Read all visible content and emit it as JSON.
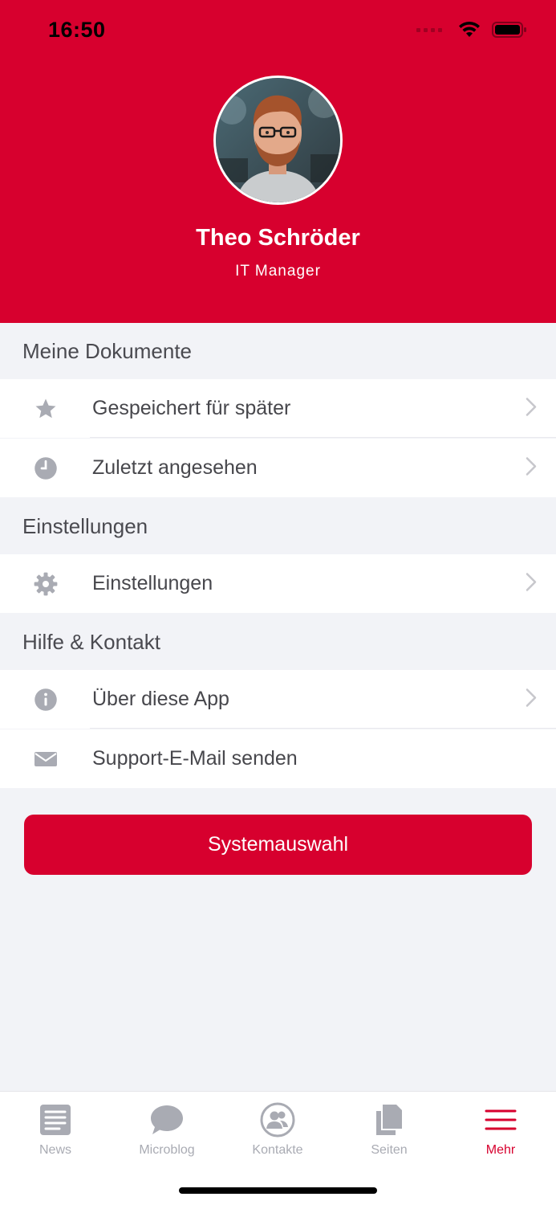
{
  "status_bar": {
    "time": "16:50"
  },
  "profile": {
    "name": "Theo Schröder",
    "role": "IT Manager"
  },
  "sections": [
    {
      "title": "Meine Dokumente",
      "items": [
        {
          "label": "Gespeichert für später",
          "icon": "star-icon"
        },
        {
          "label": "Zuletzt angesehen",
          "icon": "clock-icon"
        }
      ]
    },
    {
      "title": "Einstellungen",
      "items": [
        {
          "label": "Einstellungen",
          "icon": "gear-icon"
        }
      ]
    },
    {
      "title": "Hilfe & Kontakt",
      "items": [
        {
          "label": "Über diese App",
          "icon": "info-icon"
        },
        {
          "label": "Support-E-Mail senden",
          "icon": "mail-icon"
        }
      ]
    }
  ],
  "primary_button": {
    "label": "Systemauswahl"
  },
  "tabbar": {
    "tabs": [
      {
        "label": "News",
        "icon": "newspaper-icon"
      },
      {
        "label": "Microblog",
        "icon": "chat-bubble-icon"
      },
      {
        "label": "Kontakte",
        "icon": "contacts-icon"
      },
      {
        "label": "Seiten",
        "icon": "pages-icon"
      },
      {
        "label": "Mehr",
        "icon": "menu-icon"
      }
    ],
    "active": "Mehr"
  },
  "colors": {
    "accent": "#d7002e",
    "background": "#f2f3f7",
    "icon_gray": "#a9abb3"
  }
}
